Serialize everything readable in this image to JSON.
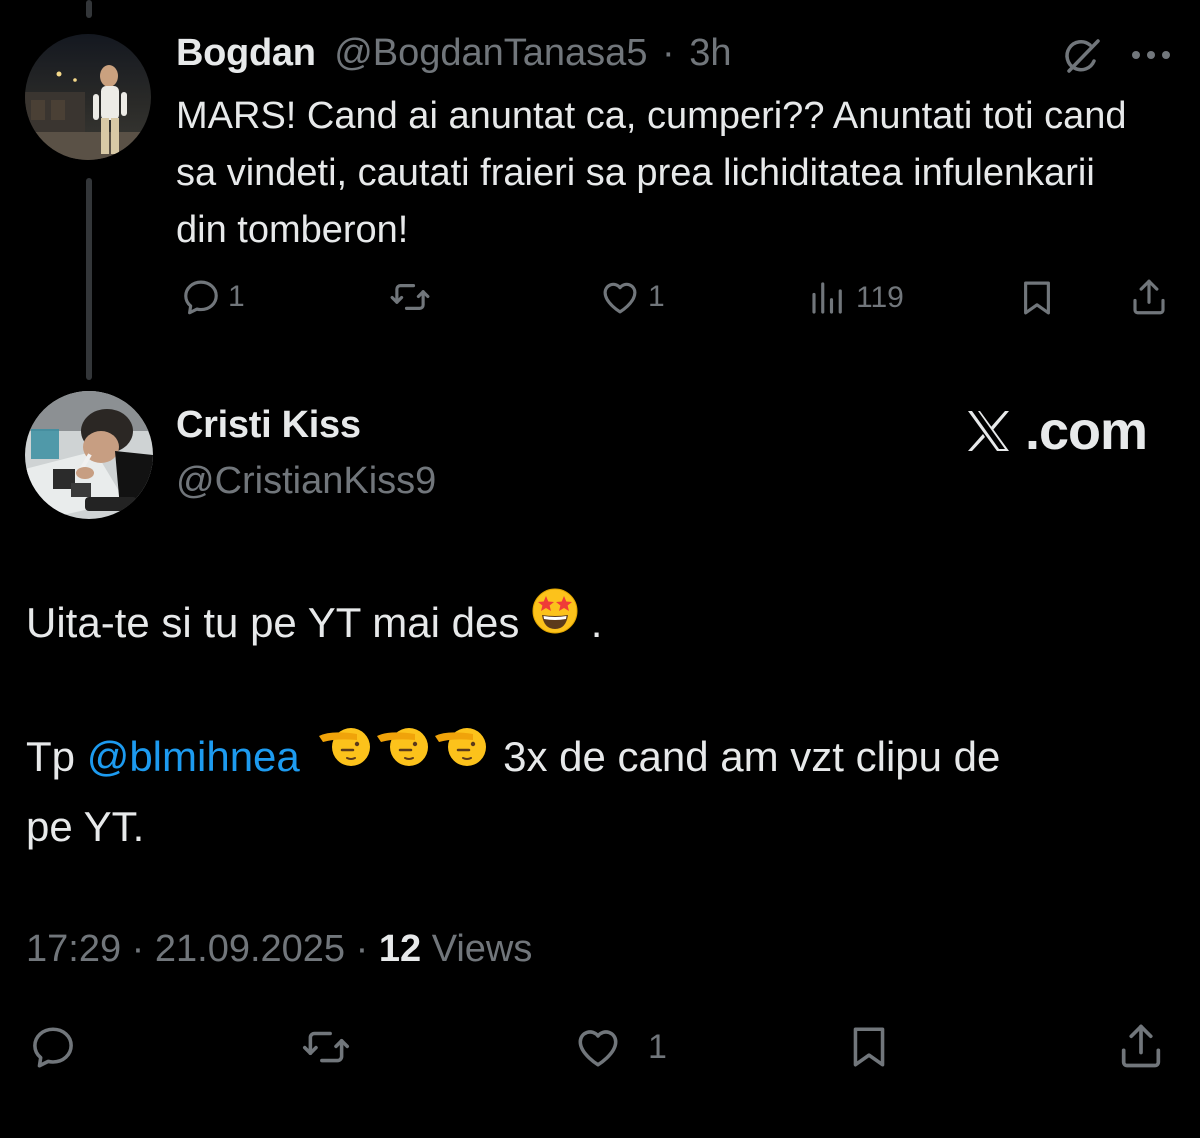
{
  "reply": {
    "author_name": "Bogdan",
    "author_handle": "@BogdanTanasa5",
    "separator": "·",
    "time": "3h",
    "text": "MARS! Cand ai anuntat ca, cumperi?? Anuntati toti cand sa vindeti, cautati fraieri sa prea lichiditatea infulenkarii din tomberon!",
    "stats": {
      "replies": "1",
      "reposts": "",
      "likes": "1",
      "views": "119"
    },
    "icons": [
      "grok-icon",
      "more-icon",
      "reply-icon",
      "repost-icon",
      "like-icon",
      "views-icon",
      "bookmark-icon",
      "share-icon"
    ]
  },
  "main_tweet": {
    "author_name": "Cristi Kiss",
    "author_handle": "@CristianKiss9",
    "watermark": "X.com",
    "line1_text": "Uita-te si tu pe YT mai des",
    "line1_suffix": ".",
    "line2_prefix": "Tp",
    "line2_mention": "@blmihnea",
    "line2_text": "3x de cand am vzt clipu de",
    "line3_text": "pe YT.",
    "emojis": [
      "star-struck-emoji",
      "saluting-face-emoji",
      "saluting-face-emoji",
      "saluting-face-emoji"
    ],
    "meta": {
      "time": "17:29",
      "separator": "·",
      "date": "21.09.2025",
      "views_count": "12",
      "views_label": "Views"
    },
    "stats": {
      "replies": "",
      "reposts": "",
      "likes": "1"
    }
  },
  "colors": {
    "background": "#000000",
    "text": "#e7e9ea",
    "muted": "#71767b",
    "link": "#1d9bf0",
    "thread_line": "#333639"
  }
}
